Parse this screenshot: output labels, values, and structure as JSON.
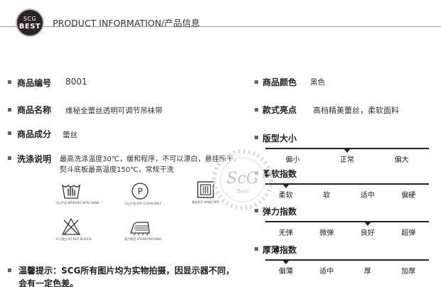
{
  "header": {
    "logo_line1": "SCG",
    "logo_line2": "BEST",
    "title": "PRODUCT INFORMATION/产品信息"
  },
  "left": {
    "code_label": "商品编号",
    "code_value": "8001",
    "name_label": "商品名称",
    "name_value": "维秘全蕾丝透明可调节吊袜带",
    "material_label": "商品成分",
    "material_value": "蕾丝",
    "wash_label": "洗涤说明",
    "wash_text": "最高洗涤温度30℃，缓和程序，不可以漂白，悬挂晾干，熨斗底板最高温度150℃，常规干洗"
  },
  "care_icons": [
    {
      "icon": "hand-wash-icon",
      "caption": "可以手洗 WASHING WITH HAND"
    },
    {
      "icon": "dry-clean-icon",
      "caption": "可以干洗 DRY CLEAN ONLY"
    },
    {
      "icon": "hang-dry-icon",
      "caption": "悬挂晾干 HANG DRY"
    },
    {
      "icon": "no-bleach-icon",
      "caption": "不可漂白 DO NOT BLEACH"
    },
    {
      "icon": "steam-iron-icon",
      "caption": "蒸汽熨烫 STEAM PRESSING"
    }
  ],
  "right": {
    "color_label": "商品颜色",
    "color_value": "黑色",
    "highlight_label": "款式亮点",
    "highlight_value": "高档精美蕾丝，柔软面料"
  },
  "scales": [
    {
      "title": "版型大小",
      "options": [
        "偏小",
        "正常",
        "偏大"
      ],
      "selected": 1
    },
    {
      "title": "柔软指数",
      "options": [
        "柔软",
        "软",
        "适中",
        "偏硬"
      ],
      "selected": 0
    },
    {
      "title": "弹力指数",
      "options": [
        "无弹",
        "微弹",
        "良好",
        "超弹"
      ],
      "selected": 2
    },
    {
      "title": "厚薄指数",
      "options": [
        "偏薄",
        "适中",
        "厚",
        "加厚"
      ],
      "selected": 0
    }
  ],
  "watermark": {
    "line1": "ScG",
    "line2": "Best"
  },
  "notice": "温馨提示：SCG所有图片均为实物拍摄，因显示器不同，会有一定色差。",
  "colors": {
    "dark": "#222222",
    "bullet": "#6b6060",
    "logo_bg": "#2b2326"
  }
}
